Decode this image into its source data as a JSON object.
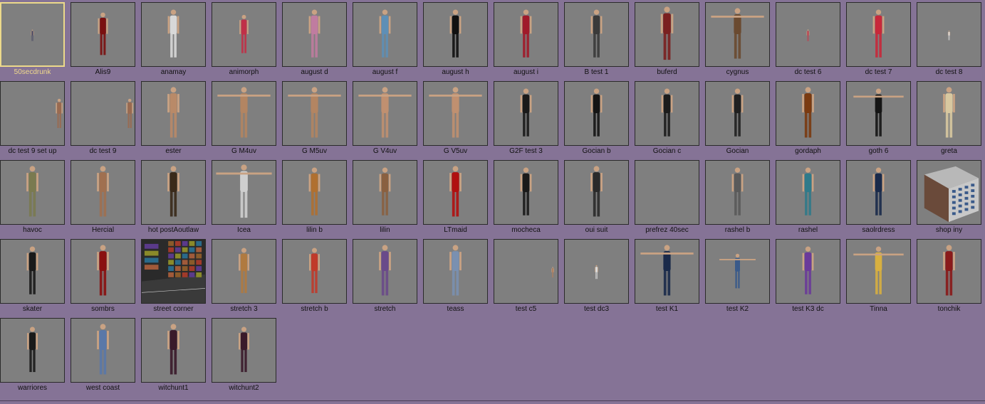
{
  "colors": {
    "background": "#857396",
    "thumb_background": "#7f7f7f",
    "thumb_border": "#2a2a2a",
    "selection": "#ecd98a",
    "label_text": "#111111",
    "selected_label_text": "#efd98b"
  },
  "selected_index": 0,
  "items": [
    {
      "label": "50secdrunk",
      "preview": "figure",
      "fill": "#4a4a66",
      "scale": 0.22
    },
    {
      "label": "Alis9",
      "preview": "figure",
      "fill": "#7a1010",
      "scale": 0.8
    },
    {
      "label": "anamay",
      "preview": "figure",
      "fill": "#d8d8d8",
      "scale": 0.9
    },
    {
      "label": "animorph",
      "preview": "figure",
      "fill": "#c03048",
      "scale": 0.72
    },
    {
      "label": "august d",
      "preview": "figure",
      "fill": "#c07ca0",
      "scale": 0.9
    },
    {
      "label": "august f",
      "preview": "figure",
      "fill": "#5e8fb6",
      "scale": 0.9
    },
    {
      "label": "august h",
      "preview": "figure",
      "fill": "#111111",
      "scale": 0.9
    },
    {
      "label": "august i",
      "preview": "figure",
      "fill": "#a01a2a",
      "scale": 0.9
    },
    {
      "label": "B test 1",
      "preview": "figure",
      "fill": "#3a3a3a",
      "scale": 0.9
    },
    {
      "label": "buferd",
      "preview": "figure",
      "fill": "#7a2020",
      "scale": 1.0
    },
    {
      "label": "cygnus",
      "preview": "tpose",
      "fill": "#6a4a30",
      "scale": 0.95
    },
    {
      "label": "dc test 6",
      "preview": "figure",
      "fill": "#c04050",
      "scale": 0.22
    },
    {
      "label": "dc test 7",
      "preview": "figure",
      "fill": "#c8283a",
      "scale": 0.9
    },
    {
      "label": "dc test 8",
      "preview": "figure",
      "fill": "#dddddd",
      "scale": 0.18
    },
    {
      "label": "dc test 9 set up",
      "preview": "edge",
      "fill": "#9a6a50",
      "scale": 0.55
    },
    {
      "label": "dc test 9",
      "preview": "edge",
      "fill": "#9a6a50",
      "scale": 0.55
    },
    {
      "label": "ester",
      "preview": "figure",
      "fill": "#b98a68",
      "scale": 0.95
    },
    {
      "label": "G M4uv",
      "preview": "tpose",
      "fill": "#b38562",
      "scale": 0.95
    },
    {
      "label": "G M5uv",
      "preview": "tpose",
      "fill": "#b38562",
      "scale": 0.95
    },
    {
      "label": "G V4uv",
      "preview": "tpose",
      "fill": "#c09070",
      "scale": 0.95
    },
    {
      "label": "G V5uv",
      "preview": "tpose",
      "fill": "#c09070",
      "scale": 0.95
    },
    {
      "label": "G2F test 3",
      "preview": "figure",
      "fill": "#1a1a1a",
      "scale": 0.9
    },
    {
      "label": "Gocian b",
      "preview": "figure",
      "fill": "#151515",
      "scale": 0.9
    },
    {
      "label": "Gocian c",
      "preview": "figure",
      "fill": "#1c1c1c",
      "scale": 0.9
    },
    {
      "label": "Gocian",
      "preview": "figure",
      "fill": "#202020",
      "scale": 0.9
    },
    {
      "label": "gordaph",
      "preview": "figure",
      "fill": "#7a3a10",
      "scale": 0.95
    },
    {
      "label": "goth 6",
      "preview": "tpose",
      "fill": "#151515",
      "scale": 0.9
    },
    {
      "label": "greta",
      "preview": "figure",
      "fill": "#d8c8a0",
      "scale": 0.95
    },
    {
      "label": "havoc",
      "preview": "figure",
      "fill": "#7a7a50",
      "scale": 0.95
    },
    {
      "label": "Hercial",
      "preview": "figure",
      "fill": "#a07050",
      "scale": 0.95
    },
    {
      "label": "hot postAoutlaw",
      "preview": "figure",
      "fill": "#3a2a1a",
      "scale": 0.95
    },
    {
      "label": "Icea",
      "preview": "tpose",
      "fill": "#cfcfcf",
      "scale": 1.0
    },
    {
      "label": "lilin b",
      "preview": "figure",
      "fill": "#b07030",
      "scale": 0.9
    },
    {
      "label": "lilin",
      "preview": "figure",
      "fill": "#8a6040",
      "scale": 0.9
    },
    {
      "label": "LTmaid",
      "preview": "figure",
      "fill": "#b01010",
      "scale": 0.95
    },
    {
      "label": "mocheca",
      "preview": "figure",
      "fill": "#1a1a1a",
      "scale": 0.9
    },
    {
      "label": "oui suit",
      "preview": "figure",
      "fill": "#2a2a2a",
      "scale": 0.95
    },
    {
      "label": "prefrez 40sec",
      "preview": "empty",
      "fill": "#7f7f7f",
      "scale": 0
    },
    {
      "label": "rashel b",
      "preview": "figure",
      "fill": "#5a5a5a",
      "scale": 0.9
    },
    {
      "label": "rashel",
      "preview": "figure",
      "fill": "#2f7a8a",
      "scale": 0.9
    },
    {
      "label": "saolrdress",
      "preview": "figure",
      "fill": "#1a2a4a",
      "scale": 0.9
    },
    {
      "label": "shop iny",
      "preview": "box",
      "fill": "#8a8a8a",
      "scale": 1.0
    },
    {
      "label": "skater",
      "preview": "figure",
      "fill": "#1a1a1a",
      "scale": 0.9
    },
    {
      "label": "sombrs",
      "preview": "figure",
      "fill": "#8a1010",
      "scale": 0.95
    },
    {
      "label": "street corner",
      "preview": "street",
      "fill": "#6a3a2a",
      "scale": 1.0
    },
    {
      "label": "stretch 3",
      "preview": "figure",
      "fill": "#b07a40",
      "scale": 0.85
    },
    {
      "label": "stretch b",
      "preview": "figure",
      "fill": "#c03a2a",
      "scale": 0.85
    },
    {
      "label": "stretch",
      "preview": "figure",
      "fill": "#6a4a8a",
      "scale": 0.95
    },
    {
      "label": "teass",
      "preview": "figure",
      "fill": "#7a90b0",
      "scale": 0.95
    },
    {
      "label": "test c5",
      "preview": "edge",
      "fill": "#b08060",
      "scale": 0.2
    },
    {
      "label": "test dc3",
      "preview": "figure",
      "fill": "#dddddd",
      "scale": 0.26
    },
    {
      "label": "test K1",
      "preview": "tpose",
      "fill": "#1a2a4a",
      "scale": 0.95
    },
    {
      "label": "test K2",
      "preview": "tpose",
      "fill": "#3a5a8a",
      "scale": 0.65
    },
    {
      "label": "test K3 dc",
      "preview": "figure",
      "fill": "#6a3a9a",
      "scale": 0.9
    },
    {
      "label": "Tinna",
      "preview": "tpose",
      "fill": "#d8b040",
      "scale": 0.9
    },
    {
      "label": "tonchik",
      "preview": "figure",
      "fill": "#8a1a1a",
      "scale": 0.95
    },
    {
      "label": "warriores",
      "preview": "figure",
      "fill": "#1a1a1a",
      "scale": 0.85
    },
    {
      "label": "west coast",
      "preview": "figure",
      "fill": "#5a78a8",
      "scale": 0.95
    },
    {
      "label": "witchunt1",
      "preview": "figure",
      "fill": "#3a1a2a",
      "scale": 0.95
    },
    {
      "label": "witchunt2",
      "preview": "figure",
      "fill": "#3a1a2a",
      "scale": 0.85
    }
  ]
}
